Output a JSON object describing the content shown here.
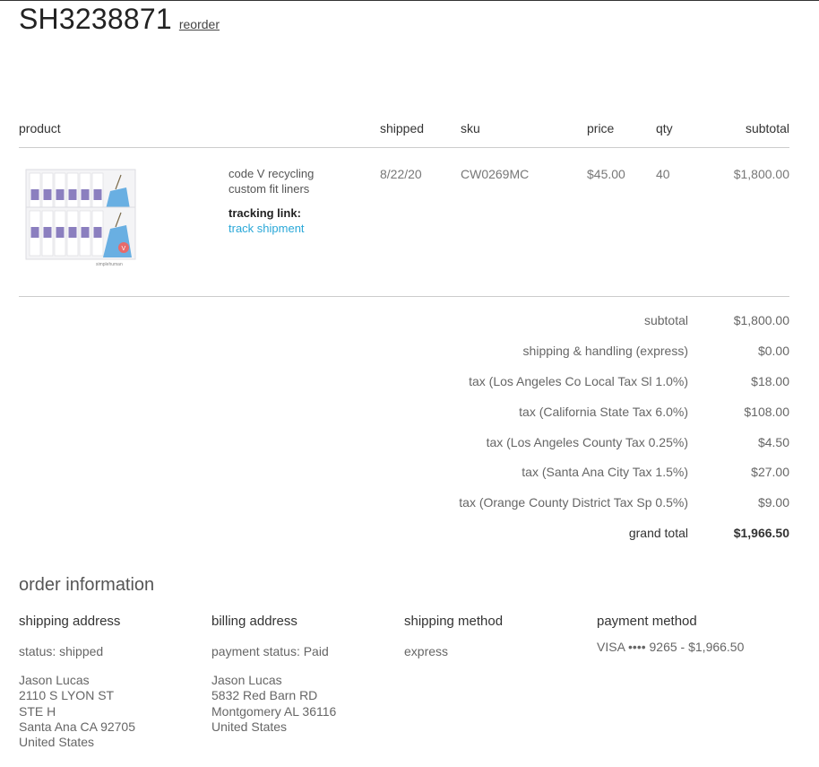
{
  "order": {
    "number": "SH3238871",
    "reorder_label": "reorder"
  },
  "table": {
    "headers": {
      "product": "product",
      "shipped": "shipped",
      "sku": "sku",
      "price": "price",
      "qty": "qty",
      "subtotal": "subtotal"
    }
  },
  "item": {
    "image_icon": "trash-liner-package-image",
    "image_brand_text": "simplehuman",
    "image_badge_text": "V",
    "name_line1": "code V recycling",
    "name_line2": "custom fit liners",
    "tracking_label": "tracking link:",
    "tracking_link_label": "track shipment",
    "shipped": "8/22/20",
    "sku": "CW0269MC",
    "price": "$45.00",
    "qty": "40",
    "subtotal": "$1,800.00"
  },
  "totals": [
    {
      "label": "subtotal",
      "value": "$1,800.00"
    },
    {
      "label": "shipping & handling (express)",
      "value": "$0.00"
    },
    {
      "label": "tax (Los Angeles Co Local Tax Sl 1.0%)",
      "value": "$18.00"
    },
    {
      "label": "tax (California State Tax 6.0%)",
      "value": "$108.00"
    },
    {
      "label": "tax (Los Angeles County Tax 0.25%)",
      "value": "$4.50"
    },
    {
      "label": "tax (Santa Ana City Tax 1.5%)",
      "value": "$27.00"
    },
    {
      "label": "tax (Orange County District Tax Sp 0.5%)",
      "value": "$9.00"
    },
    {
      "label": "grand total",
      "value": "$1,966.50"
    }
  ],
  "order_information": {
    "title": "order information",
    "shipping_address": {
      "title": "shipping address",
      "status": "status: shipped",
      "lines": [
        "Jason Lucas",
        "2110 S LYON ST",
        "STE H",
        "Santa Ana CA 92705",
        "United States"
      ]
    },
    "billing_address": {
      "title": "billing address",
      "status": "payment status: Paid",
      "lines": [
        "Jason Lucas",
        "5832 Red Barn RD",
        "Montgomery AL 36116",
        "United States"
      ]
    },
    "shipping_method": {
      "title": "shipping method",
      "value": "express"
    },
    "payment_method": {
      "title": "payment method",
      "value": "VISA •••• 9265 - $1,966.50"
    }
  },
  "colors": {
    "link": "#2aa8d8",
    "liner_blue": "#5aa7e0",
    "badge_red": "#e86a6a"
  }
}
